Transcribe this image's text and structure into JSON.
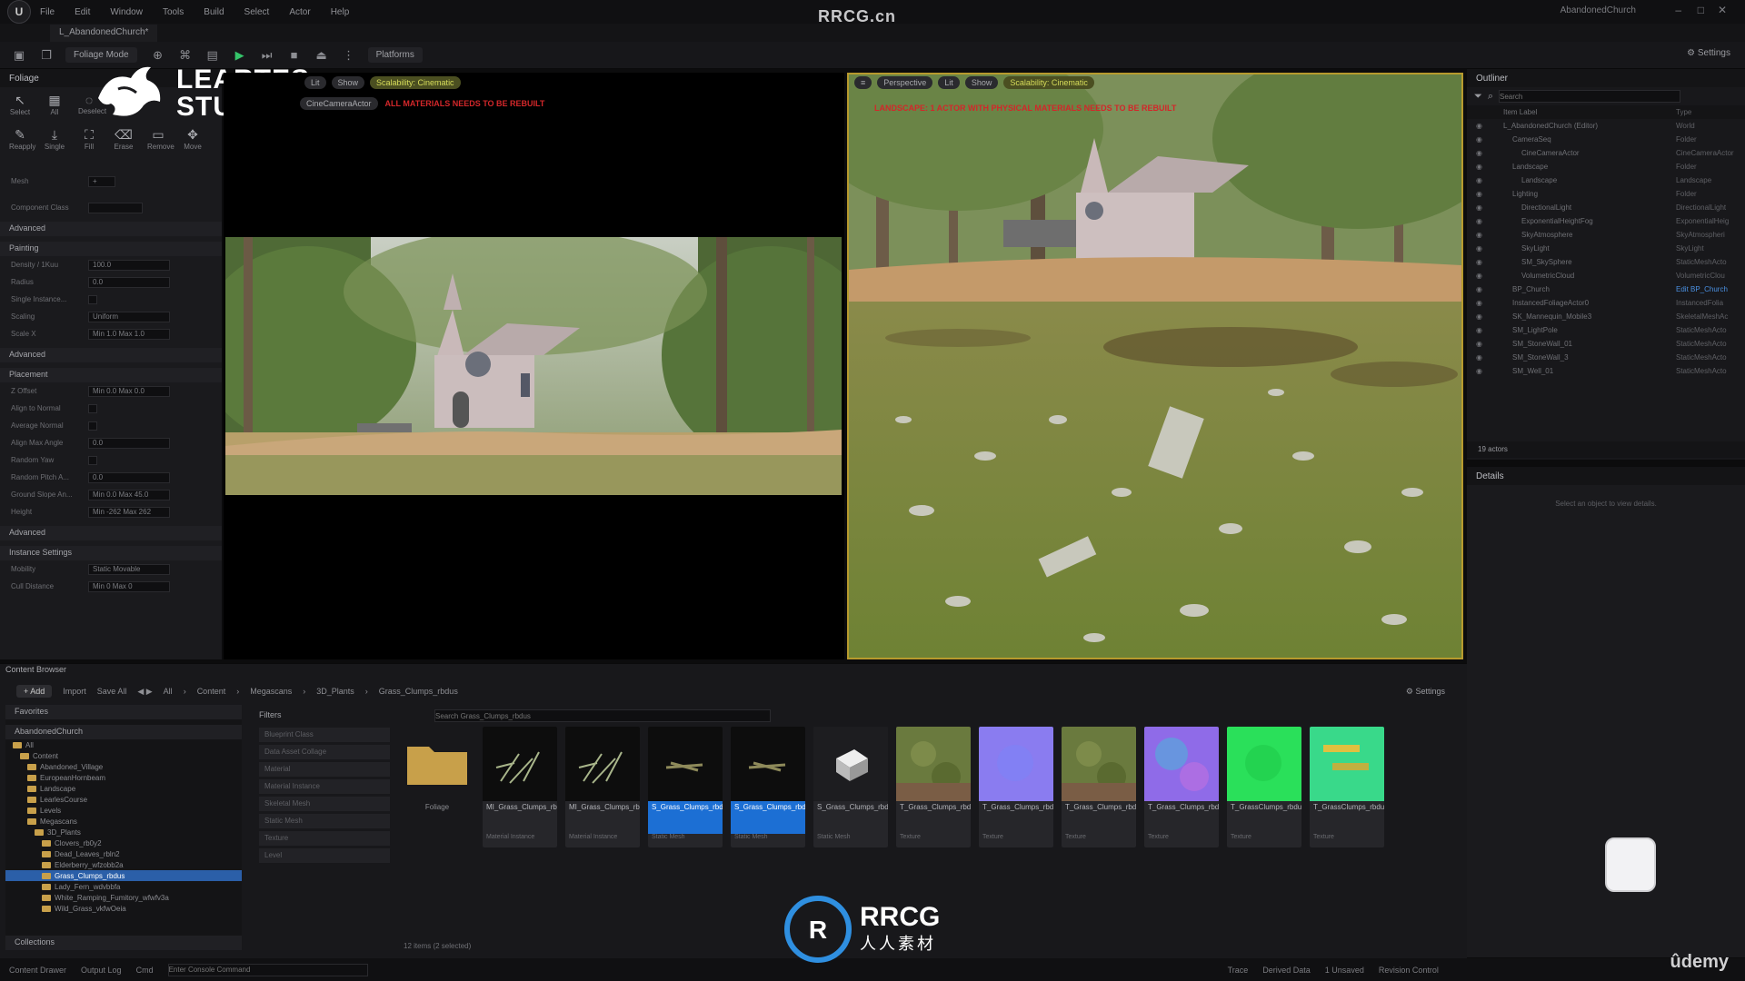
{
  "menubar": {
    "items": [
      "File",
      "Edit",
      "Window",
      "Tools",
      "Build",
      "Select",
      "Actor",
      "Help"
    ],
    "watermark": "RRCG.cn",
    "project": "AbandonedChurch"
  },
  "level_tab": "L_AbandonedChurch*",
  "toolbar": {
    "mode": "Foliage Mode",
    "platforms": "Platforms",
    "settings": "Settings"
  },
  "foliage": {
    "title": "Foliage",
    "tools": [
      "Select",
      "All",
      "Deselect",
      "Invalid",
      "Lasso",
      "Paint",
      "Reapply",
      "Single",
      "Fill",
      "Erase",
      "Remove",
      "Move"
    ],
    "mesh_label": "Mesh",
    "component_class": "Component Class",
    "sections": [
      "Advanced",
      "Painting",
      "Advanced",
      "Placement",
      "Advanced",
      "Instance Settings"
    ],
    "painting": [
      {
        "name": "Density / 1Kuu",
        "value": "100.0"
      },
      {
        "name": "Radius",
        "value": "0.0"
      },
      {
        "name": "Single Instance...",
        "value": ""
      },
      {
        "name": "Scaling",
        "value": "Uniform"
      },
      {
        "name": "Scale X",
        "value": "Min  1.0   Max  1.0"
      }
    ],
    "placement": [
      {
        "name": "Z Offset",
        "value": "Min  0.0   Max  0.0"
      },
      {
        "name": "Align to Normal",
        "value": ""
      },
      {
        "name": "Average Normal",
        "value": ""
      },
      {
        "name": "Align Max Angle",
        "value": "0.0"
      },
      {
        "name": "Random Yaw",
        "value": ""
      },
      {
        "name": "Random Pitch A...",
        "value": "0.0"
      },
      {
        "name": "Ground Slope An...",
        "value": "Min 0.0  Max 45.0"
      },
      {
        "name": "Height",
        "value": "Min -262  Max 262"
      }
    ],
    "instance": [
      {
        "name": "Mobility",
        "value": "Static   Movable"
      },
      {
        "name": "Cull Distance",
        "value": "Min 0   Max 0"
      }
    ]
  },
  "brand": {
    "line1": "LEARTES",
    "line2": "STUDIOS"
  },
  "viewport_left": {
    "camera": "CineCameraActor",
    "warning": "ALL MATERIALS NEEDS TO BE REBUILT",
    "show": "Show",
    "scalability": "Scalability: Cinematic",
    "lit": "Lit"
  },
  "viewport_right": {
    "perspective": "Perspective",
    "lit": "Lit",
    "show": "Show",
    "scalability": "Scalability: Cinematic",
    "warning": "LANDSCAPE: 1 ACTOR WITH PHYSICAL MATERIALS NEEDS TO BE REBUILT"
  },
  "outliner": {
    "title": "Outliner",
    "search_placeholder": "Search",
    "col_label": "Item Label",
    "col_type": "Type",
    "rows": [
      {
        "label": "L_AbandonedChurch (Editor)",
        "type": "World",
        "indent": 0
      },
      {
        "label": "CameraSeq",
        "type": "Folder",
        "indent": 1
      },
      {
        "label": "CineCameraActor",
        "type": "CineCameraActor",
        "indent": 2
      },
      {
        "label": "Landscape",
        "type": "Folder",
        "indent": 1
      },
      {
        "label": "Landscape",
        "type": "Landscape",
        "indent": 2
      },
      {
        "label": "Lighting",
        "type": "Folder",
        "indent": 1
      },
      {
        "label": "DirectionalLight",
        "type": "DirectionalLight",
        "indent": 2
      },
      {
        "label": "ExponentialHeightFog",
        "type": "ExponentialHeig",
        "indent": 2
      },
      {
        "label": "SkyAtmosphere",
        "type": "SkyAtmospheri",
        "indent": 2
      },
      {
        "label": "SkyLight",
        "type": "SkyLight",
        "indent": 2
      },
      {
        "label": "SM_SkySphere",
        "type": "StaticMeshActo",
        "indent": 2
      },
      {
        "label": "VolumetricCloud",
        "type": "VolumetricClou",
        "indent": 2
      },
      {
        "label": "BP_Church",
        "type": "Edit BP_Church",
        "indent": 1
      },
      {
        "label": "InstancedFoliageActor0",
        "type": "InstancedFolia",
        "indent": 1
      },
      {
        "label": "SK_Mannequin_Mobile3",
        "type": "SkeletalMeshAc",
        "indent": 1
      },
      {
        "label": "SM_LightPole",
        "type": "StaticMeshActo",
        "indent": 1
      },
      {
        "label": "SM_StoneWall_01",
        "type": "StaticMeshActo",
        "indent": 1
      },
      {
        "label": "SM_StoneWall_3",
        "type": "StaticMeshActo",
        "indent": 1
      },
      {
        "label": "SM_Well_01",
        "type": "StaticMeshActo",
        "indent": 1
      }
    ],
    "count": "19 actors"
  },
  "details": {
    "title": "Details",
    "empty": "Select an object to view details."
  },
  "content_browser": {
    "title": "Content Browser",
    "add": "Add",
    "import": "Import",
    "save_all": "Save All",
    "path": [
      "All",
      "Content",
      "Megascans",
      "3D_Plants",
      "Grass_Clumps_rbdus"
    ],
    "settings": "Settings",
    "search_placeholder": "Search Grass_Clumps_rbdus",
    "favorites": "Favorites",
    "project": "AbandonedChurch",
    "collections": "Collections",
    "filters_title": "Filters",
    "filters": [
      "Blueprint Class",
      "Data Asset Collage",
      "Material",
      "Material Instance",
      "Skeletal Mesh",
      "Static Mesh",
      "Texture",
      "Level"
    ],
    "tree": [
      {
        "label": "All",
        "indent": 0,
        "selected": false
      },
      {
        "label": "Content",
        "indent": 1,
        "selected": false
      },
      {
        "label": "Abandoned_Village",
        "indent": 2,
        "selected": false
      },
      {
        "label": "EuropeanHornbeam",
        "indent": 2,
        "selected": false
      },
      {
        "label": "Landscape",
        "indent": 2,
        "selected": false
      },
      {
        "label": "LearlesCourse",
        "indent": 2,
        "selected": false
      },
      {
        "label": "Levels",
        "indent": 2,
        "selected": false
      },
      {
        "label": "Megascans",
        "indent": 2,
        "selected": false
      },
      {
        "label": "3D_Plants",
        "indent": 3,
        "selected": false
      },
      {
        "label": "Clovers_rb0y2",
        "indent": 4,
        "selected": false
      },
      {
        "label": "Dead_Leaves_rbln2",
        "indent": 4,
        "selected": false
      },
      {
        "label": "Elderberry_wfzobb2a",
        "indent": 4,
        "selected": false
      },
      {
        "label": "Grass_Clumps_rbdus",
        "indent": 4,
        "selected": true
      },
      {
        "label": "Lady_Fern_wdvbbfa",
        "indent": 4,
        "selected": false
      },
      {
        "label": "White_Ramping_Fumitory_wfwfv3a",
        "indent": 4,
        "selected": false
      },
      {
        "label": "Wild_Grass_vkfwOeia",
        "indent": 4,
        "selected": false
      }
    ],
    "assets": [
      {
        "name": "Foliage",
        "type": "",
        "kind": "folder"
      },
      {
        "name": "MI_Grass_Clumps_rbdus_2K",
        "type": "Material Instance",
        "kind": "dark"
      },
      {
        "name": "MI_Grass_Clumps_rbdus_Billboard_2K",
        "type": "Material Instance",
        "kind": "dark"
      },
      {
        "name": "S_Grass_Clumps_rbdus_Var1_lod1",
        "type": "Static Mesh",
        "kind": "dark-sel"
      },
      {
        "name": "S_Grass_Clumps_rbdus_Var2_lod1",
        "type": "Static Mesh",
        "kind": "dark-sel"
      },
      {
        "name": "S_Grass_Clumps_rbdus_Var3_lod1",
        "type": "Static Mesh",
        "kind": "box"
      },
      {
        "name": "T_Grass_Clumps_rbdus_2K_D",
        "type": "Texture",
        "kind": "albedo"
      },
      {
        "name": "T_Grass_Clumps_rbdus_2K_N",
        "type": "Texture",
        "kind": "normal"
      },
      {
        "name": "T_Grass_Clumps_rbdus_Billboard_2K_D",
        "type": "Texture",
        "kind": "albedo"
      },
      {
        "name": "T_Grass_Clumps_rbdus_Billboard_2K_N",
        "type": "Texture",
        "kind": "normal2"
      },
      {
        "name": "T_GrassClumps_rbdus_2K_ART",
        "type": "Texture",
        "kind": "green"
      },
      {
        "name": "T_GrassClumps_rbdus_2K_Billboard_ART",
        "type": "Texture",
        "kind": "green2"
      }
    ],
    "count": "12 items (2 selected)"
  },
  "statusbar": {
    "drawer": "Content Drawer",
    "output": "Output Log",
    "cmd": "Cmd",
    "cmd_placeholder": "Enter Console Command",
    "trace": "Trace",
    "derived": "Derived Data",
    "unsaved": "1 Unsaved",
    "revision": "Revision Control"
  },
  "footer_brand": {
    "title": "RRCG",
    "subtitle": "人人素材",
    "udemy": "ûdemy"
  }
}
